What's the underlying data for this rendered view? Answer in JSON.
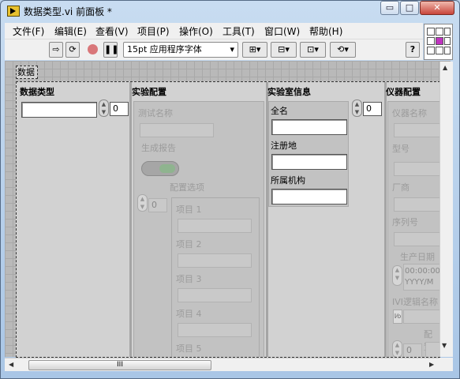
{
  "window": {
    "title": "数据类型.vi 前面板 *",
    "min_glyph": "▭",
    "max_glyph": "□",
    "close_glyph": "✕"
  },
  "menu": [
    "文件(F)",
    "编辑(E)",
    "查看(V)",
    "项目(P)",
    "操作(O)",
    "工具(T)",
    "窗口(W)",
    "帮助(H)"
  ],
  "toolbar": {
    "font_select": "15pt 应用程序字体",
    "help": "?"
  },
  "cluster": {
    "label": "数据",
    "col1": {
      "title": "数据类型",
      "index": "0"
    },
    "col2": {
      "title": "实验配置",
      "test_name": "测试名称",
      "report": "生成报告",
      "cfg_options": "配置选项",
      "cfg_index": "0",
      "items": [
        "项目 1",
        "项目 2",
        "项目 3",
        "项目 4",
        "项目 5"
      ]
    },
    "col3": {
      "title": "实验室信息",
      "index": "0",
      "fullname": "全名",
      "reg": "注册地",
      "org": "所属机构"
    },
    "col4": {
      "title": "仪器配置",
      "name": "仪器名称",
      "model": "型号",
      "vendor": "厂商",
      "serial": "序列号",
      "date": "生产日期",
      "time_val": "00:00:00.",
      "date_val": "YYYY/M",
      "ivi": "IVI逻辑名称",
      "ivi_icon": "I⁄o",
      "cfg": "配置",
      "cfg_index": "0"
    }
  },
  "hscroll_thumb": "III"
}
